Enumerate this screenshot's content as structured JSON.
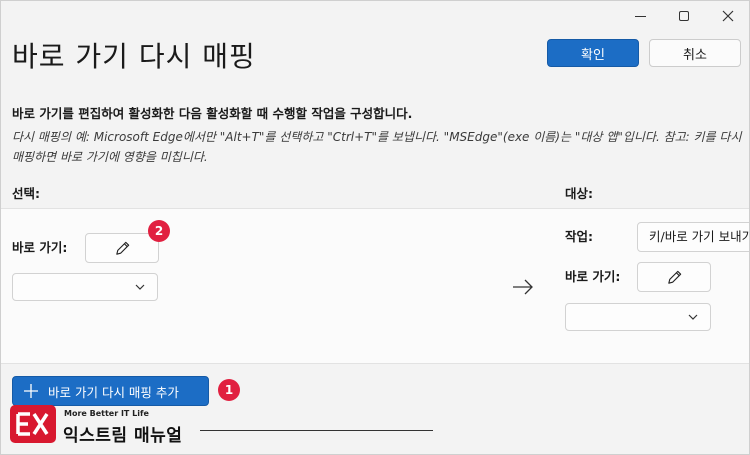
{
  "window": {
    "controls": [
      "minimize",
      "maximize",
      "close"
    ]
  },
  "page": {
    "title": "바로 가기 다시 매핑"
  },
  "buttons": {
    "confirm": "확인",
    "cancel": "취소",
    "add_remap": "바로 가기 다시 매핑 추가"
  },
  "description": {
    "bold": "바로 가기를 편집하여 활성화한 다음 활성화할 때 수행할 작업을 구성합니다.",
    "example": "다시 매핑의 예: Microsoft Edge에서만 \"Alt+T\"를 선택하고 \"Ctrl+T\"를 보냅니다. \"MSEdge\"(exe 이름)는 \"대상 앱\"입니다. 참고: 키를 다시 매핑하면 바로 가기에 영향을 미칩니다."
  },
  "columns": {
    "select": "선택:",
    "target": "대상:"
  },
  "row": {
    "shortcut_label": "바로 가기:",
    "action_label": "작업:",
    "action_value": "키/바로 가기 보내기",
    "target_shortcut_label": "바로 가기:",
    "source_dropdown_value": "",
    "target_dropdown_value": ""
  },
  "badges": {
    "one": "1",
    "two": "2"
  },
  "icons": {
    "edit": "pencil-icon",
    "dropdown": "chevron-down-icon",
    "arrow": "arrow-right-icon",
    "add": "plus-icon"
  },
  "watermark": {
    "tagline": "More Better IT Life",
    "name": "익스트림 매뉴얼"
  },
  "colors": {
    "accent": "#1c6dc5",
    "badge": "#e12040",
    "logo": "#d8182f"
  }
}
